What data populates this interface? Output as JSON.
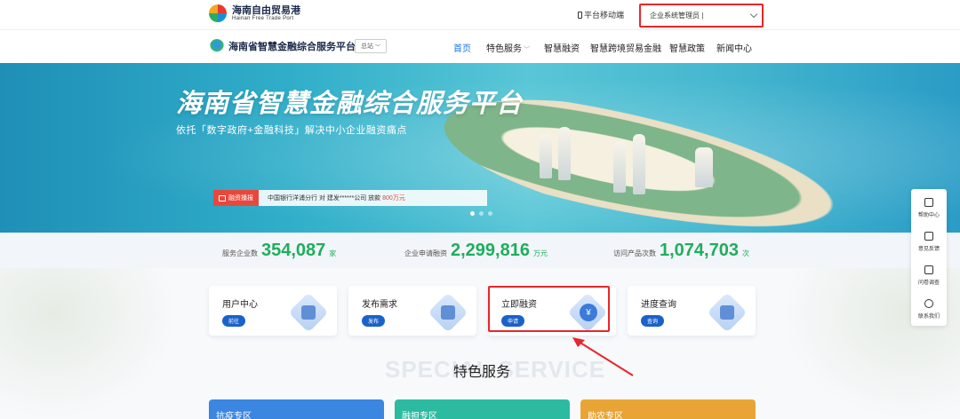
{
  "topbar": {
    "logo_cn": "海南自由贸易港",
    "logo_en": "Hainan Free Trade Port",
    "mobile_label": "平台移动端",
    "user_select_value": "企业系统管理员 |"
  },
  "navbar": {
    "platform_name": "海南省智慧金融综合服务平台",
    "region": "总站",
    "items": [
      {
        "label": "首页",
        "active": true
      },
      {
        "label": "特色服务"
      },
      {
        "label": "智慧融资"
      },
      {
        "label": "智慧跨境贸易金融"
      },
      {
        "label": "智慧政策"
      },
      {
        "label": "新闻中心"
      }
    ]
  },
  "banner": {
    "title": "海南省智慧金融综合服务平台",
    "subtitle": "依托「数字政府+金融科技」解决中小企业融资痛点",
    "ticker_tag": "融资播报",
    "ticker_msg": "中国银行洋浦分行 对 建发******公司 放款",
    "ticker_amount": "800万元"
  },
  "stats": [
    {
      "label": "服务企业数",
      "value": "354,087",
      "unit": "家"
    },
    {
      "label": "企业申请融资",
      "value": "2,299,816",
      "unit": "万元"
    },
    {
      "label": "访问产品次数",
      "value": "1,074,703",
      "unit": "次"
    }
  ],
  "cards": [
    {
      "title": "用户中心",
      "button": "前往"
    },
    {
      "title": "发布需求",
      "button": "发布"
    },
    {
      "title": "立即融资",
      "button": "申请",
      "coin": "¥"
    },
    {
      "title": "进度查询",
      "button": "查询"
    }
  ],
  "section": {
    "watermark": "SPECIAL SERVICE",
    "title": "特色服务"
  },
  "zones": [
    {
      "label": "抗疫专区",
      "color": "#3a86e0"
    },
    {
      "label": "融担专区",
      "color": "#2cbba1"
    },
    {
      "label": "助农专区",
      "color": "#e8a535"
    }
  ],
  "float_menu": [
    {
      "label": "帮助中心",
      "icon": "chat-icon"
    },
    {
      "label": "意见反馈",
      "icon": "edit-icon"
    },
    {
      "label": "问卷调查",
      "icon": "clipboard-icon"
    },
    {
      "label": "联系我们",
      "icon": "phone-icon"
    }
  ],
  "colors": {
    "accent": "#1a62c9",
    "stat_green": "#1fae5d",
    "highlight_red": "#e8262b"
  }
}
